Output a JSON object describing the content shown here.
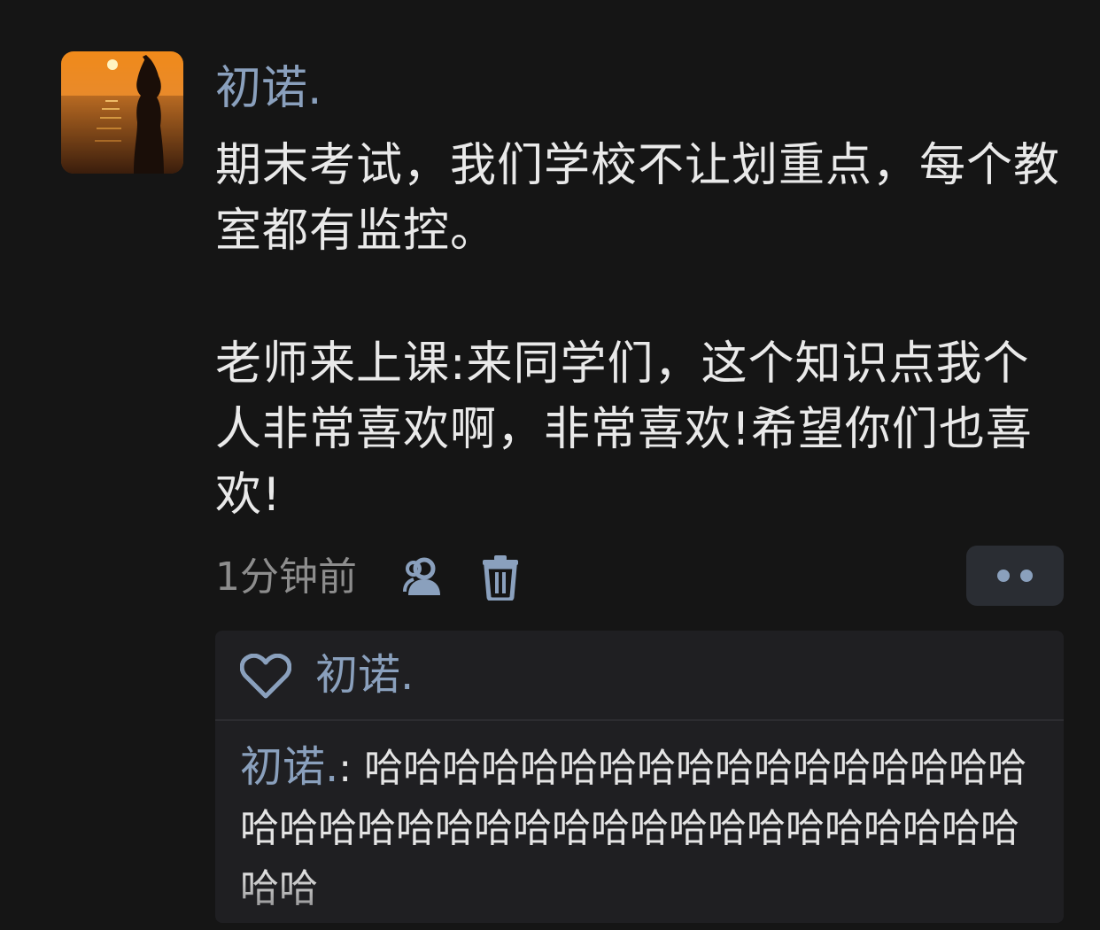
{
  "post": {
    "author": "初诺.",
    "avatar_icon": "sunset-beach-avatar",
    "paragraphs": [
      "期末考试，我们学校不让划重点，每个教室都有监控。",
      "老师来上课:来同学们，这个知识点我个人非常喜欢啊，非常喜欢!希望你们也喜欢!"
    ],
    "timestamp": "1分钟前",
    "visibility_icon": "friends-visibility-icon",
    "delete_icon": "trash-icon",
    "more_icon": "more-dots-icon"
  },
  "interactions": {
    "like_icon": "heart-icon",
    "liked_by": "初诺.",
    "comments": [
      {
        "author": "初诺.",
        "separator": ": ",
        "text": "哈哈哈哈哈哈哈哈哈哈哈哈哈哈哈哈哈哈哈哈哈哈哈哈哈哈哈哈哈哈哈哈哈哈哈哈哈哈哈"
      }
    ]
  },
  "colors": {
    "background": "#151515",
    "name_accent": "#8aa0bd",
    "text_primary": "#e9e9e9",
    "text_secondary": "#8d8d8d",
    "panel": "#1f1f22"
  }
}
